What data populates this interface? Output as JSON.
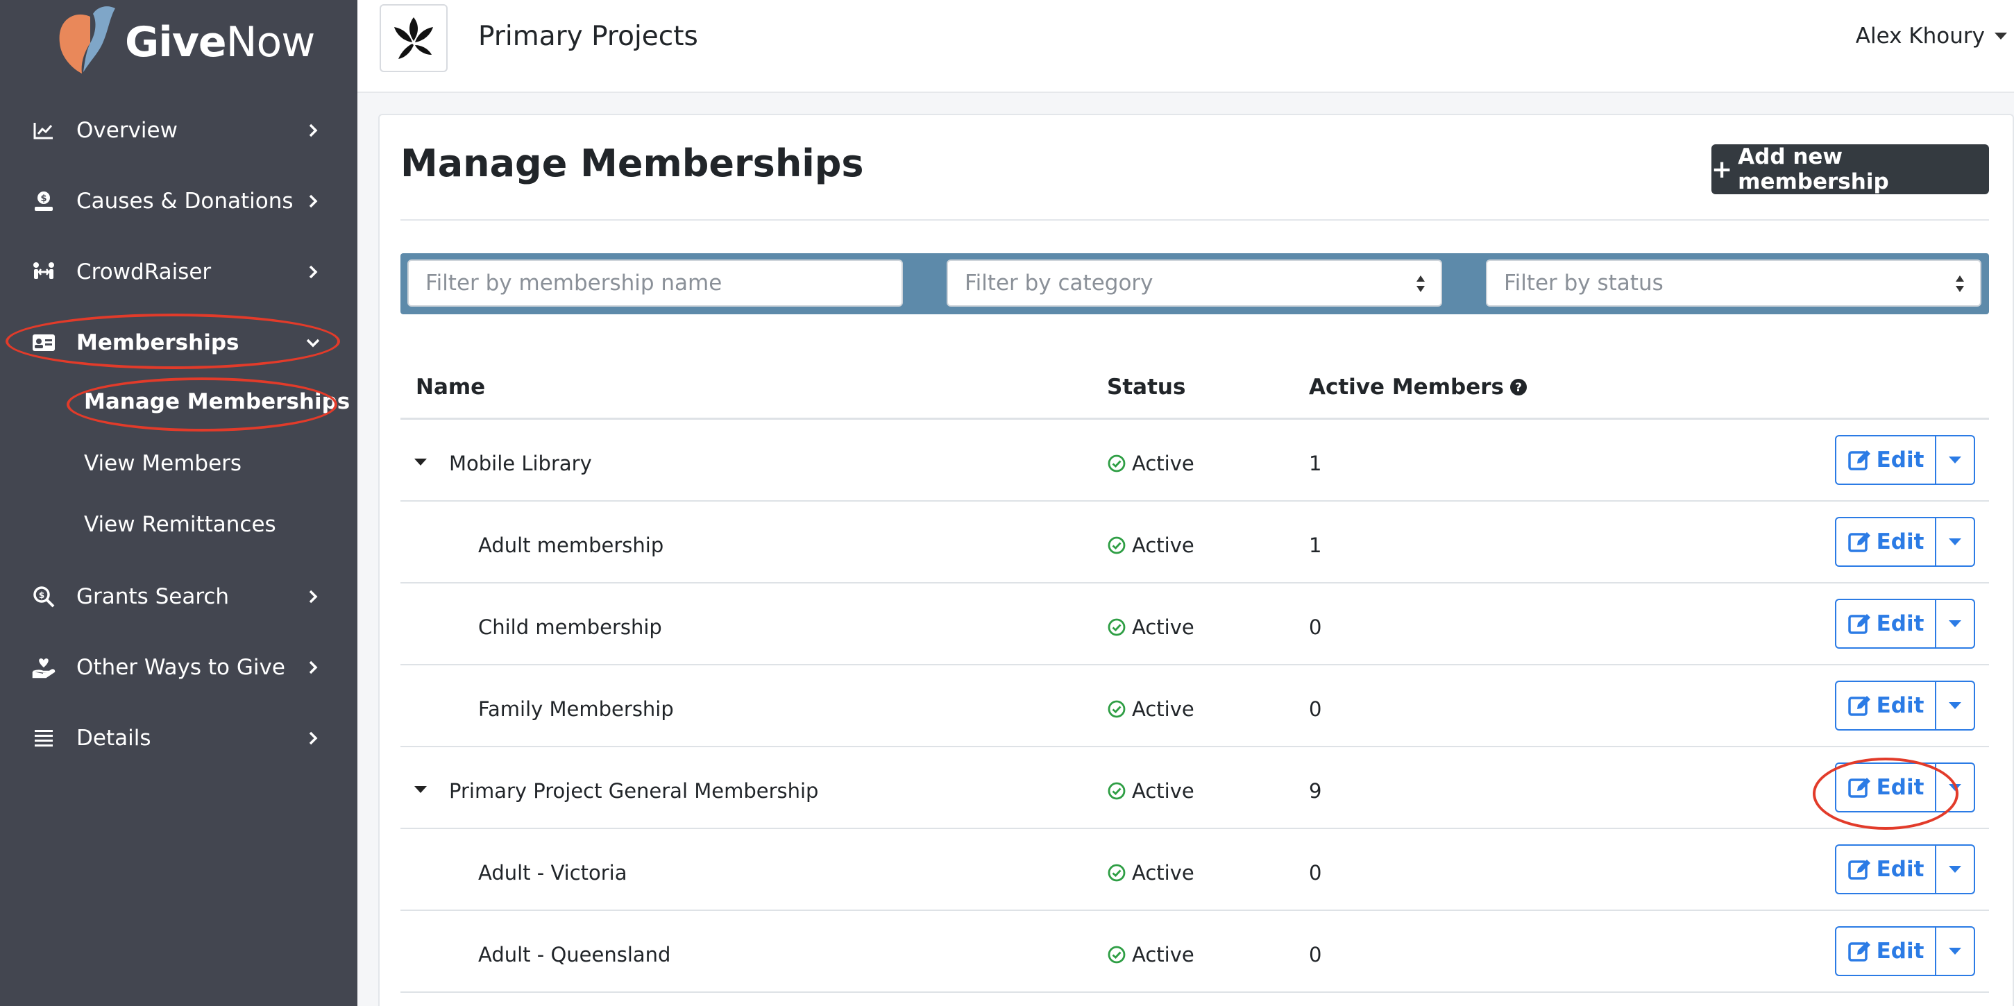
{
  "brand": {
    "name_bold": "Give",
    "name_light": "Now"
  },
  "header": {
    "org_name": "Primary Projects",
    "user_name": "Alex Khoury"
  },
  "sidebar": {
    "items": [
      {
        "label": "Overview",
        "icon": "chart-line-icon"
      },
      {
        "label": "Causes & Donations",
        "icon": "hand-holding-dollar-icon"
      },
      {
        "label": "CrowdRaiser",
        "icon": "people-arrows-icon"
      },
      {
        "label": "Memberships",
        "icon": "id-card-icon"
      },
      {
        "label": "Grants Search",
        "icon": "search-dollar-icon"
      },
      {
        "label": "Other Ways to Give",
        "icon": "hand-holding-heart-icon"
      },
      {
        "label": "Details",
        "icon": "list-icon"
      }
    ],
    "subitems": [
      {
        "label": "Manage Memberships"
      },
      {
        "label": "View Members"
      },
      {
        "label": "View Remittances"
      }
    ]
  },
  "page": {
    "title": "Manage Memberships",
    "add_button": "Add new membership"
  },
  "filters": {
    "name_placeholder": "Filter by membership name",
    "category_placeholder": "Filter by category",
    "status_placeholder": "Filter by status"
  },
  "table": {
    "headers": {
      "name": "Name",
      "status": "Status",
      "active_members": "Active Members"
    },
    "edit_label": "Edit",
    "rows": [
      {
        "name": "Mobile Library",
        "status": "Active",
        "members": "1"
      },
      {
        "name": "Adult membership",
        "status": "Active",
        "members": "1"
      },
      {
        "name": "Child membership",
        "status": "Active",
        "members": "0"
      },
      {
        "name": "Family Membership",
        "status": "Active",
        "members": "0"
      },
      {
        "name": "Primary Project General Membership",
        "status": "Active",
        "members": "9"
      },
      {
        "name": "Adult - Victoria",
        "status": "Active",
        "members": "0"
      },
      {
        "name": "Adult - Queensland",
        "status": "Active",
        "members": "0"
      }
    ]
  },
  "colors": {
    "sidebar_bg": "#434650",
    "accent_blue": "#2b7be5",
    "filter_bar": "#5d8aaa",
    "status_green": "#2e9e44",
    "annotation_red": "#e23b2a"
  }
}
